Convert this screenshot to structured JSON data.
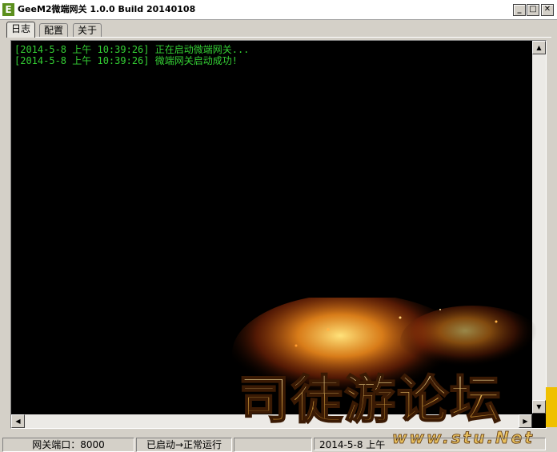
{
  "window": {
    "app_icon": "E",
    "title": "GeeM2微端网关 1.0.0 Build 20140108",
    "controls": {
      "minimize": "_",
      "maximize": "□",
      "close": "✕"
    }
  },
  "tabs": [
    {
      "label": "日志",
      "active": true
    },
    {
      "label": "配置",
      "active": false
    },
    {
      "label": "关于",
      "active": false
    }
  ],
  "log": {
    "lines": [
      "[2014-5-8 上午 10:39:26] 正在启动微端网关...",
      "[2014-5-8 上午 10:39:26] 微端网关启动成功!"
    ],
    "text_color": "#34d034",
    "background": "#000000"
  },
  "scrollbar": {
    "up": "▲",
    "down": "▼",
    "left": "◀",
    "right": "▶"
  },
  "statusbar": {
    "port": "网关端口：8000",
    "state": "已启动→正常运行",
    "empty": "",
    "time": "2014-5-8 上午"
  },
  "watermark": {
    "text": "司徒游论坛",
    "subtext": "www.stu.Net"
  }
}
